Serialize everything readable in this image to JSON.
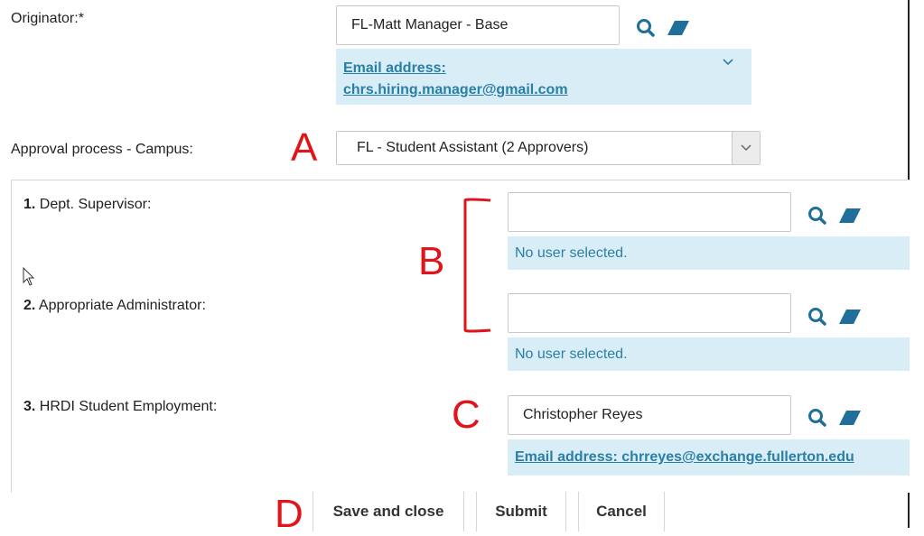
{
  "originator": {
    "label": "Originator:*",
    "value": "FL-Matt Manager - Base",
    "email_label": "Email address:",
    "email": "chrs.hiring.manager@gmail.com"
  },
  "approval": {
    "label": "Approval process - Campus:",
    "selected": "FL - Student Assistant (2 Approvers)"
  },
  "approvers": [
    {
      "num": "1.",
      "label": "Dept. Supervisor:",
      "value": "",
      "status": "No user selected."
    },
    {
      "num": "2.",
      "label": "Appropriate Administrator:",
      "value": "",
      "status": "No user selected."
    },
    {
      "num": "3.",
      "label": "HRDI Student Employment:",
      "value": "Christopher Reyes",
      "status": "Email address: chrreyes@exchange.fullerton.edu"
    }
  ],
  "markers": {
    "a": "A",
    "b": "B",
    "c": "C",
    "d": "D"
  },
  "buttons": {
    "save": "Save and close",
    "submit": "Submit",
    "cancel": "Cancel"
  },
  "colors": {
    "info_bg": "#d9edf7",
    "link": "#2a7fa6",
    "icon": "#1f6f9a",
    "marker": "#e0141a"
  },
  "icons": {
    "lookup": "search-icon",
    "clear": "eraser-icon"
  }
}
